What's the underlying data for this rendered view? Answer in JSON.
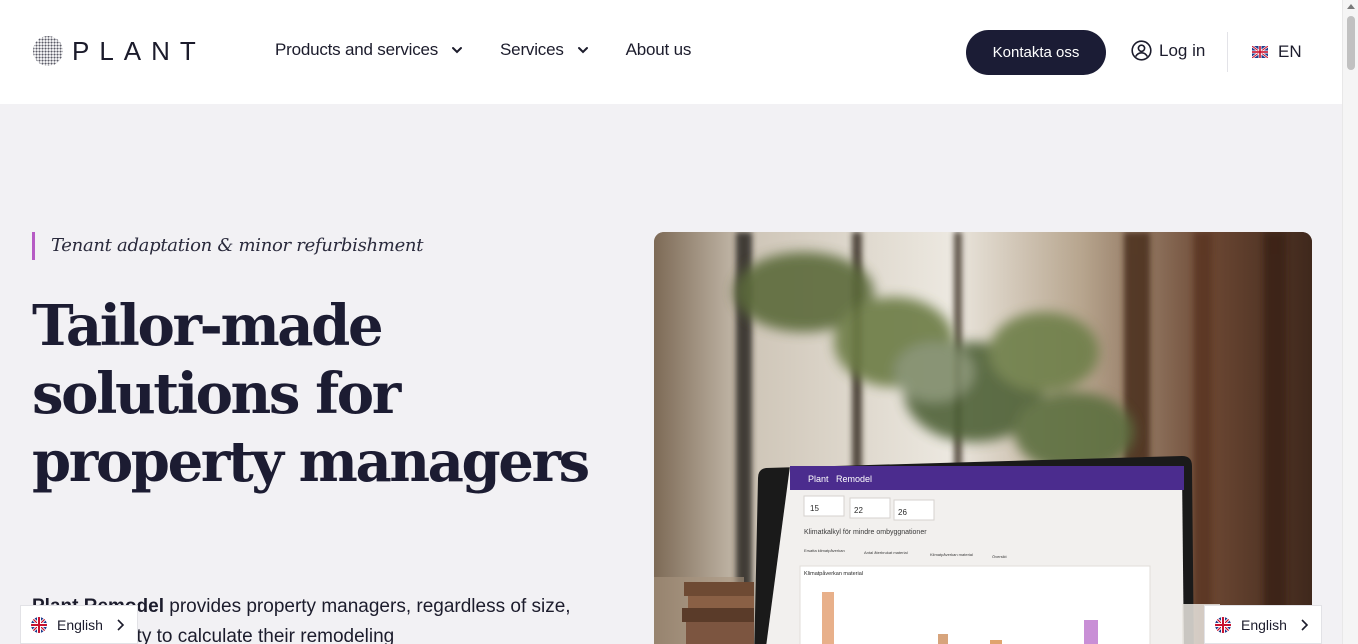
{
  "header": {
    "logo_text": "PLANT",
    "nav": [
      {
        "label": "Products and services",
        "has_dropdown": true
      },
      {
        "label": "Services",
        "has_dropdown": true
      },
      {
        "label": "About us",
        "has_dropdown": false
      }
    ],
    "cta_label": "Kontakta oss",
    "login_label": "Log in",
    "language_code": "EN"
  },
  "hero": {
    "eyebrow": "Tenant adaptation & minor refurbishment",
    "headline": "Tailor-made solutions for property managers",
    "intro_bold": "Plant Remodel",
    "intro_rest": " provides property managers, regardless of size, with the ability to calculate their remodeling"
  },
  "laptop_screen": {
    "brand": "Plant",
    "product": "Remodel",
    "stats": [
      "15",
      "22",
      "26"
    ],
    "title": "Klimatkalkyl för mindre ombyggnationer",
    "tabs": [
      "Ersatta klimatpåverkan",
      "Antal återbrukat material",
      "Klimatpåverkan material",
      "Översikt"
    ],
    "chart_title": "Klimatpåverkan material"
  },
  "language_widgets": {
    "left_label": "English",
    "right_label": "English"
  },
  "colors": {
    "accent_purple": "#b65bc4",
    "navy": "#1b1c35",
    "screen_header": "#4b2c8e"
  }
}
